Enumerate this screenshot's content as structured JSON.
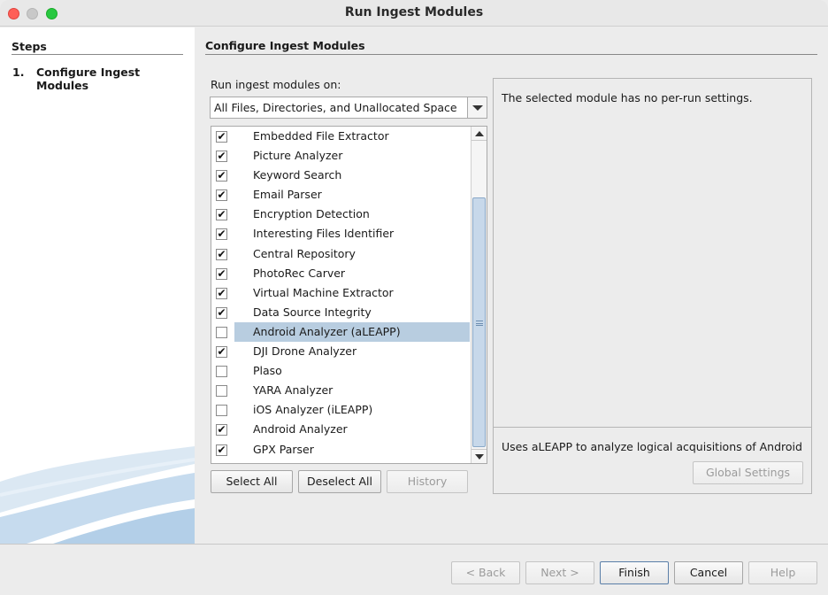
{
  "window": {
    "title": "Run Ingest Modules"
  },
  "steps": {
    "header": "Steps",
    "items": [
      {
        "number": "1.",
        "label": "Configure Ingest Modules"
      }
    ]
  },
  "main": {
    "header": "Configure Ingest Modules",
    "run_on_label": "Run ingest modules on:",
    "run_on_value": "All Files, Directories, and Unallocated Space",
    "modules": [
      {
        "name": "Embedded File Extractor",
        "checked": true
      },
      {
        "name": "Picture Analyzer",
        "checked": true
      },
      {
        "name": "Keyword Search",
        "checked": true
      },
      {
        "name": "Email Parser",
        "checked": true
      },
      {
        "name": "Encryption Detection",
        "checked": true
      },
      {
        "name": "Interesting Files Identifier",
        "checked": true
      },
      {
        "name": "Central Repository",
        "checked": true
      },
      {
        "name": "PhotoRec Carver",
        "checked": true
      },
      {
        "name": "Virtual Machine Extractor",
        "checked": true
      },
      {
        "name": "Data Source Integrity",
        "checked": true
      },
      {
        "name": "Android Analyzer (aLEAPP)",
        "checked": false,
        "selected": true
      },
      {
        "name": "DJI Drone Analyzer",
        "checked": true
      },
      {
        "name": "Plaso",
        "checked": false
      },
      {
        "name": "YARA Analyzer",
        "checked": false
      },
      {
        "name": "iOS Analyzer (iLEAPP)",
        "checked": false
      },
      {
        "name": "Android Analyzer",
        "checked": true
      },
      {
        "name": "GPX Parser",
        "checked": true
      }
    ],
    "select_all_label": "Select All",
    "deselect_all_label": "Deselect All",
    "history_label": "History",
    "settings_message": "The selected module has no per-run settings.",
    "module_description": "Uses aLEAPP to analyze logical acquisitions of Android ...",
    "global_settings_label": "Global Settings"
  },
  "footer": {
    "back_label": "< Back",
    "next_label": "Next >",
    "finish_label": "Finish",
    "cancel_label": "Cancel",
    "help_label": "Help"
  },
  "colors": {
    "selection": "#b8cde0",
    "close": "#ff5f57",
    "maximize": "#28c840"
  }
}
